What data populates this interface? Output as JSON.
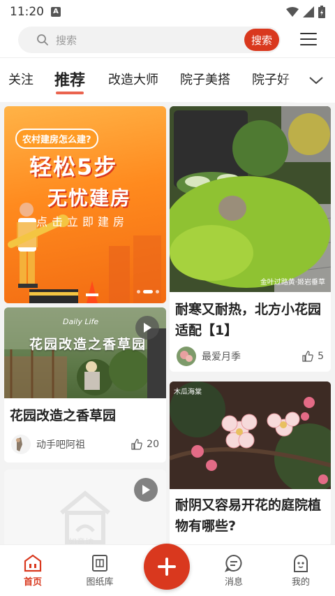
{
  "status_bar": {
    "time": "11:20",
    "notification_letter": "A"
  },
  "search": {
    "placeholder": "搜索",
    "button_label": "搜索"
  },
  "tabs": [
    {
      "label": "关注",
      "active": false
    },
    {
      "label": "推荐",
      "active": true
    },
    {
      "label": "改造大师",
      "active": false
    },
    {
      "label": "院子美搭",
      "active": false
    },
    {
      "label": "院子好",
      "active": false
    }
  ],
  "banner": {
    "tagline": "农村建房怎么建?",
    "headline_1": "轻松5步",
    "headline_2": "无忧建房",
    "subline": "点击立即建房"
  },
  "feed": {
    "left": [
      {
        "image_text": "花园改造之香草园",
        "image_caption": "Daily Life",
        "title": "花园改造之香草园",
        "author": "动手吧阿祖",
        "likes": "20",
        "has_video": true
      },
      {
        "placeholder_text": "如意坊",
        "has_video": true
      }
    ],
    "right": [
      {
        "watermark": "金叶过路黄·姬岩垂草",
        "title": "耐寒又耐热，北方小花园适配【1】",
        "author": "最爱月季",
        "likes": "5"
      },
      {
        "watermark": "木瓜海棠",
        "title": "耐阴又容易开花的庭院植物有哪些?"
      }
    ]
  },
  "bottom_nav": {
    "items": [
      {
        "label": "首页",
        "icon": "home-icon",
        "active": true
      },
      {
        "label": "图纸库",
        "icon": "blueprint-icon",
        "active": false
      },
      {
        "label": "消息",
        "icon": "message-icon",
        "active": false
      },
      {
        "label": "我的",
        "icon": "profile-icon",
        "active": false
      }
    ]
  },
  "colors": {
    "accent": "#d9381e",
    "banner_orange": "#ff8a1e"
  }
}
